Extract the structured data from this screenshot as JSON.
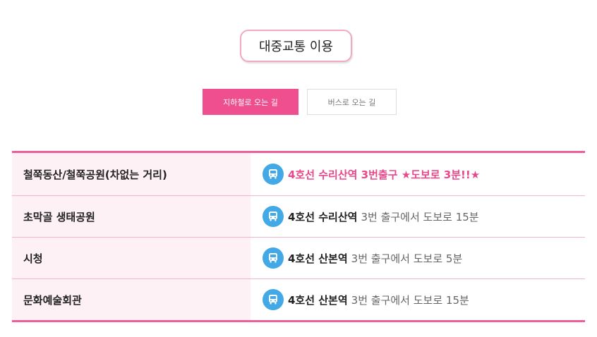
{
  "section_title": "대중교통 이용",
  "tabs": {
    "subway": "지하철로 오는 길",
    "bus": "버스로 오는 길"
  },
  "colors": {
    "accent": "#ef4f8e",
    "row_bg": "#fdf1f6",
    "icon_blue": "#43a9e6"
  },
  "routes": [
    {
      "place": "철쭉동산/철쭉공원(차없는 거리)",
      "text": "4호선 수리산역 3번출구 ★도보로 3분!!★",
      "icon": "bus-icon"
    },
    {
      "place": "초막골 생태공원",
      "line": "4호선 수리산역",
      "detail": "3번 출구에서 도보로 15분",
      "icon": "bus-icon"
    },
    {
      "place": "시청",
      "line": "4호선 산본역",
      "detail": "3번 출구에서 도보로 5분",
      "icon": "bus-icon"
    },
    {
      "place": "문화예술회관",
      "line": "4호선 산본역",
      "detail": "3번 출구에서 도보로 15분",
      "icon": "bus-icon"
    }
  ]
}
